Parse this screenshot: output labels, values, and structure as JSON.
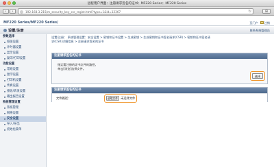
{
  "window": {
    "title": "远程用户界面：注册请求签名的证书：MF220 Series：MF220 Series",
    "url": "192.168.3.215/m_security_key_csr_regist.html?type=1&id=12367"
  },
  "header": {
    "model": "MF220 Series/MF220 Series/",
    "top_links": [
      "至门户",
      "注销"
    ],
    "title": "设置/注册",
    "right_link": "联系系统管理员"
  },
  "sidebar": {
    "sections": [
      {
        "label": "参数选择",
        "items": [
          "纸张设置",
          "计时器设置",
          "显示设置",
          "复印/打印设置"
        ]
      },
      {
        "label": "功能设置",
        "items": [
          "常规设置",
          "复印设置",
          "打印机设置",
          "传真设置",
          "接收/转发设置",
          "输出报告设置"
        ]
      },
      {
        "label": "系统管理设置",
        "items": [
          "系统管理",
          "网络设置",
          "安全设置",
          "导入/导出",
          "初始化菜单"
        ]
      }
    ],
    "active_item": "安全设置"
  },
  "main": {
    "breadcrumb_line1": "设置/注册： 系统管理设置：安全设置 > 密钥和证书设置 > 生成密钥 > 生成密钥和证书签名请求(CSR) > 密钥和证书签名请",
    "breadcrumb_line2": "求(CSR)详细信息 > 注册请求签名的证书",
    "panel1": {
      "title": "注册请求签名的证书",
      "desc_line1": "指定要注册的证书文件的路径。",
      "desc_line2": "单击[浏览]选择文件。",
      "select_label": "选择"
    },
    "panel2": {
      "title": "注册请求签名的证书",
      "field_label": "文件路径：",
      "choose_label": "选取文件",
      "no_file_text": "未选择文件"
    }
  }
}
